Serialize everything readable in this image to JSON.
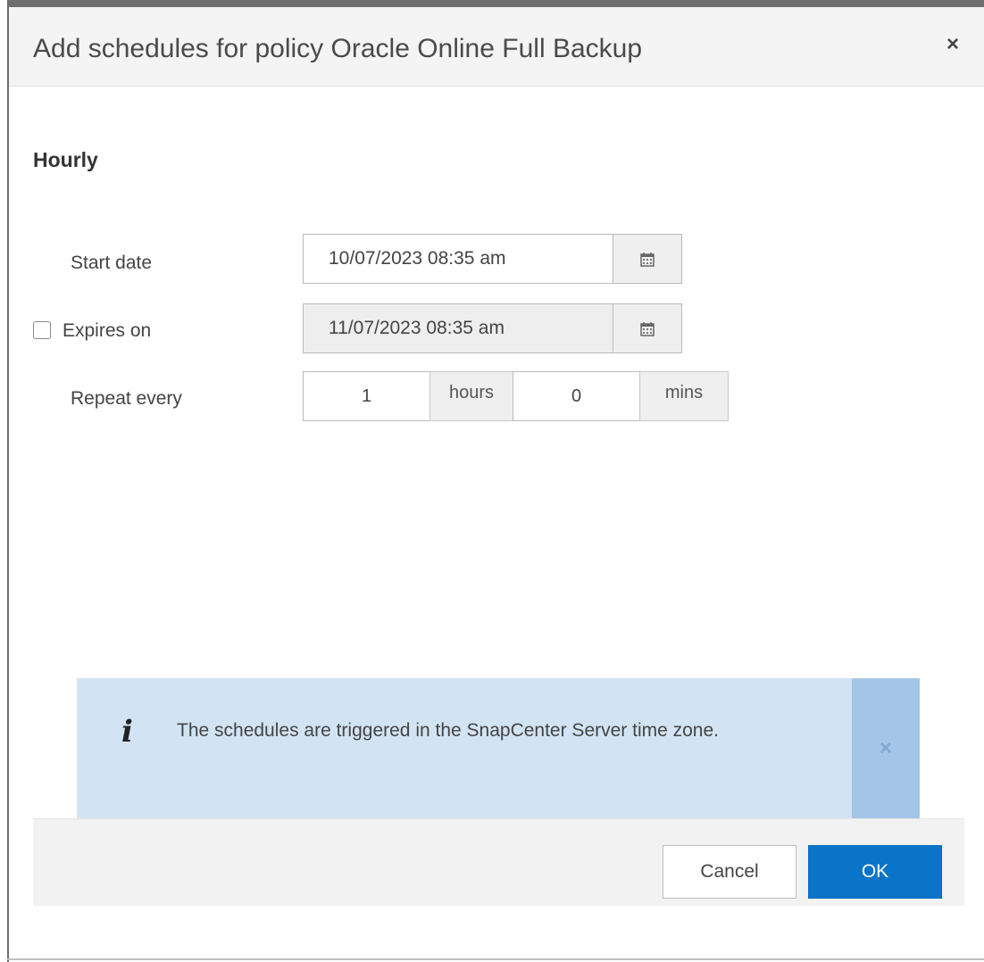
{
  "dialog": {
    "title": "Add schedules for policy Oracle Online Full Backup",
    "close_glyph": "×"
  },
  "schedule": {
    "frequency": "Hourly",
    "start_date": {
      "label": "Start date",
      "value": "10/07/2023 08:35 am",
      "icon": "calendar-icon"
    },
    "expires_on": {
      "label": "Expires on",
      "checked": false,
      "value": "11/07/2023 08:35 am",
      "icon": "calendar-icon"
    },
    "repeat_every": {
      "label": "Repeat every",
      "hours_value": "1",
      "hours_unit": "hours",
      "mins_value": "0",
      "mins_unit": "mins"
    }
  },
  "info": {
    "icon": "info-icon",
    "glyph": "i",
    "message": "The schedules are triggered in the SnapCenter Server time zone.",
    "close_glyph": "×"
  },
  "footer": {
    "cancel_label": "Cancel",
    "ok_label": "OK"
  },
  "colors": {
    "primary": "#0a74c9",
    "info_bg": "#d2e4f4",
    "info_close_bg": "#a4c6e6"
  }
}
